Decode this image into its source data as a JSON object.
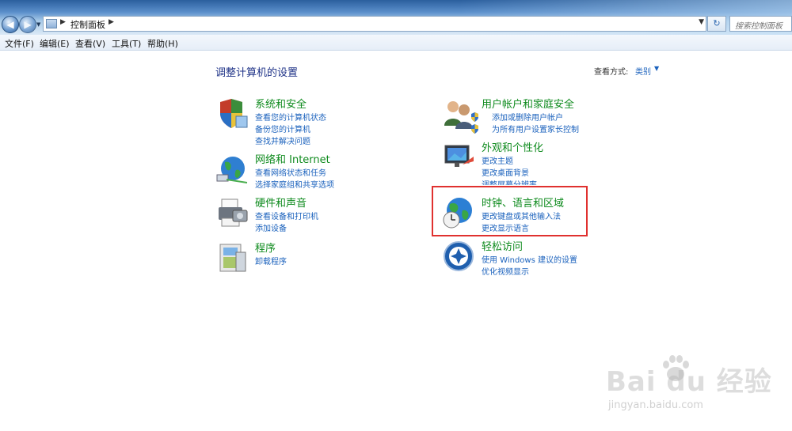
{
  "address_bar": {
    "path_label": "控制面板",
    "search_placeholder": "搜索控制面板"
  },
  "menu": {
    "file": "文件(F)",
    "edit": "编辑(E)",
    "view": "查看(V)",
    "tools": "工具(T)",
    "help": "帮助(H)"
  },
  "main": {
    "heading": "调整计算机的设置",
    "view_by_label": "查看方式:",
    "view_by_value": "类别"
  },
  "categories": {
    "system_security": {
      "title": "系统和安全",
      "links": [
        "查看您的计算机状态",
        "备份您的计算机",
        "查找并解决问题"
      ],
      "icon": "shield-flag-icon"
    },
    "network": {
      "title": "网络和 Internet",
      "links": [
        "查看网络状态和任务",
        "选择家庭组和共享选项"
      ],
      "icon": "network-globe-icon"
    },
    "hardware": {
      "title": "硬件和声音",
      "links": [
        "查看设备和打印机",
        "添加设备"
      ],
      "icon": "printer-icon"
    },
    "programs": {
      "title": "程序",
      "links": [
        "卸载程序"
      ],
      "icon": "programs-icon"
    },
    "user_accounts": {
      "title": "用户帐户和家庭安全",
      "links": [
        "添加或删除用户帐户",
        "为所有用户设置家长控制"
      ],
      "icon": "users-icon"
    },
    "appearance": {
      "title": "外观和个性化",
      "links": [
        "更改主题",
        "更改桌面背景",
        "调整屏幕分辨率"
      ],
      "icon": "monitor-icon"
    },
    "clock_region": {
      "title": "时钟、语言和区域",
      "links": [
        "更改键盘或其他输入法",
        "更改显示语言"
      ],
      "icon": "globe-clock-icon"
    },
    "ease_access": {
      "title": "轻松访问",
      "links": [
        "使用 Windows 建议的设置",
        "优化视频显示"
      ],
      "icon": "ease-access-icon"
    }
  },
  "watermark": {
    "brand": "Bai du 经验",
    "url": "jingyan.baidu.com"
  },
  "colors": {
    "category_title": "#0f8b1e",
    "link": "#1b62bd",
    "heading": "#1e3287",
    "highlight": "#e0312f"
  }
}
